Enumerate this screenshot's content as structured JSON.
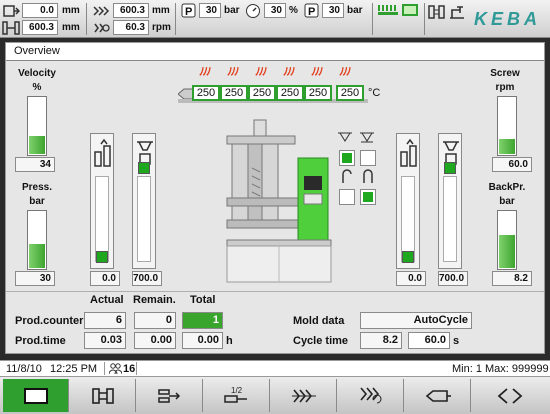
{
  "topbar": {
    "position_1": "0.0",
    "position_1_unit": "mm",
    "position_2": "600.3",
    "position_2_unit": "mm",
    "stroke_1": "600.3",
    "stroke_1_unit": "mm",
    "screw_speed": "60.3",
    "screw_speed_unit": "rpm",
    "pressure_1": "30",
    "pressure_1_unit": "bar",
    "percent": "30",
    "percent_unit": "%",
    "pressure_2": "30",
    "pressure_2_unit": "bar",
    "brand": "KEBA"
  },
  "panel": {
    "title": "Overview",
    "velocity_label": "Velocity",
    "velocity_unit": "%",
    "velocity_value": "34",
    "velocity_level": 0.34,
    "press_label": "Press.",
    "press_unit": "bar",
    "press_value": "30",
    "press_level": 0.45,
    "screw_label": "Screw",
    "screw_unit": "rpm",
    "screw_value": "60.0",
    "screw_level": 0.3,
    "backpr_label": "BackPr.",
    "backpr_unit": "bar",
    "backpr_value": "8.2",
    "backpr_level": 0.6,
    "ejector_value": "0.0",
    "mold_value": "700.0",
    "right_col1_value": "0.0",
    "right_col2_value": "700.0",
    "temp_unit": "°C",
    "zones": [
      "250",
      "250",
      "250",
      "250",
      "250",
      "250"
    ],
    "heat_symbol": "ﾉﾉﾉ"
  },
  "production": {
    "actual_header": "Actual",
    "remain_header": "Remain.",
    "total_header": "Total",
    "counter_label": "Prod.counter",
    "counter_actual": "6",
    "counter_remain": "0",
    "counter_total": "1",
    "time_label": "Prod.time",
    "time_actual": "0.03",
    "time_remain": "0.00",
    "time_total": "0.00",
    "time_unit": "h",
    "mold_data_label": "Mold data",
    "mode_value": "AutoCycle",
    "cycle_time_label": "Cycle time",
    "cycle_time_actual": "8.2",
    "cycle_time_set": "60.0",
    "cycle_time_unit": "s"
  },
  "status": {
    "date": "11/8/10",
    "time": "12:25 PM",
    "users": "16",
    "minmax": "Min: 1 Max: 999999"
  },
  "colors": {
    "accent_green": "#2fa02f",
    "brand_teal": "#2f9a98",
    "heat_red": "#e23c1a"
  }
}
